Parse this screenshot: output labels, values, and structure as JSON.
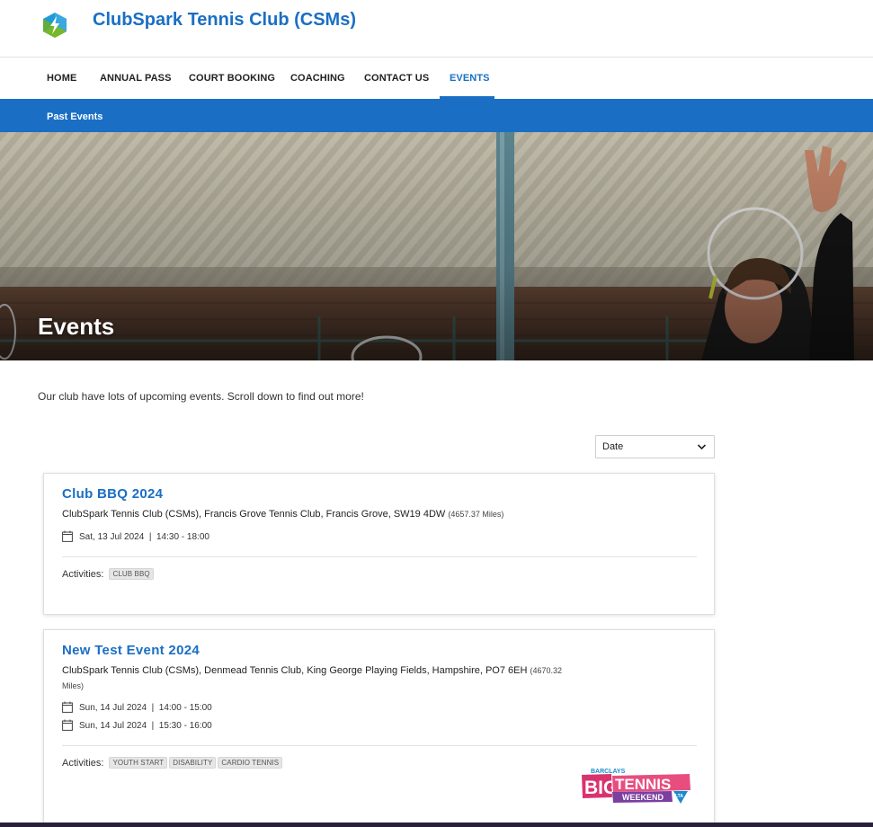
{
  "header": {
    "club_name": "ClubSpark Tennis Club (CSMs)",
    "logo_icon": "lightning-bolt-hexagon-icon"
  },
  "nav": {
    "items": [
      {
        "label": "HOME",
        "active": false
      },
      {
        "label": "ANNUAL PASS",
        "active": false
      },
      {
        "label": "COURT BOOKING",
        "active": false
      },
      {
        "label": "COACHING",
        "active": false
      },
      {
        "label": "CONTACT US",
        "active": false
      },
      {
        "label": "EVENTS",
        "active": true
      }
    ]
  },
  "subnav": {
    "items": [
      {
        "label": "Past Events"
      }
    ]
  },
  "hero": {
    "title": "Events"
  },
  "intro_text": "Our club have lots of upcoming events. Scroll down to find out more!",
  "sort": {
    "selected": "Date"
  },
  "events": [
    {
      "title": "Club BBQ 2024",
      "location": "ClubSpark Tennis Club (CSMs), Francis Grove Tennis Club, Francis Grove, SW19 4DW",
      "distance": "(4657.37 Miles)",
      "dates": [
        {
          "date": "Sat, 13 Jul 2024",
          "time": "14:30 - 18:00"
        }
      ],
      "activities_label": "Activities:",
      "activities": [
        "CLUB BBQ"
      ]
    },
    {
      "title": "New Test Event 2024",
      "location": "ClubSpark Tennis Club (CSMs), Denmead Tennis Club, King George Playing Fields, Hampshire, PO7 6EH",
      "distance": "(4670.32 Miles)",
      "dates": [
        {
          "date": "Sun, 14 Jul 2024",
          "time": "14:00 - 15:00"
        },
        {
          "date": "Sun, 14 Jul 2024",
          "time": "15:30 - 16:00"
        }
      ],
      "activities_label": "Activities:",
      "activities": [
        "YOUTH START",
        "DISABILITY",
        "CARDIO TENNIS"
      ],
      "badge": {
        "sponsor": "BARCLAYS",
        "line1": "BIG",
        "line2": "TENNIS",
        "line3": "WEEKEND",
        "mark": "LTA"
      }
    }
  ],
  "colors": {
    "brand_blue": "#1a6fc4",
    "tag_bg": "#e6e6e6",
    "badge_pink": "#d9336e",
    "badge_purple": "#7b3fa0"
  }
}
